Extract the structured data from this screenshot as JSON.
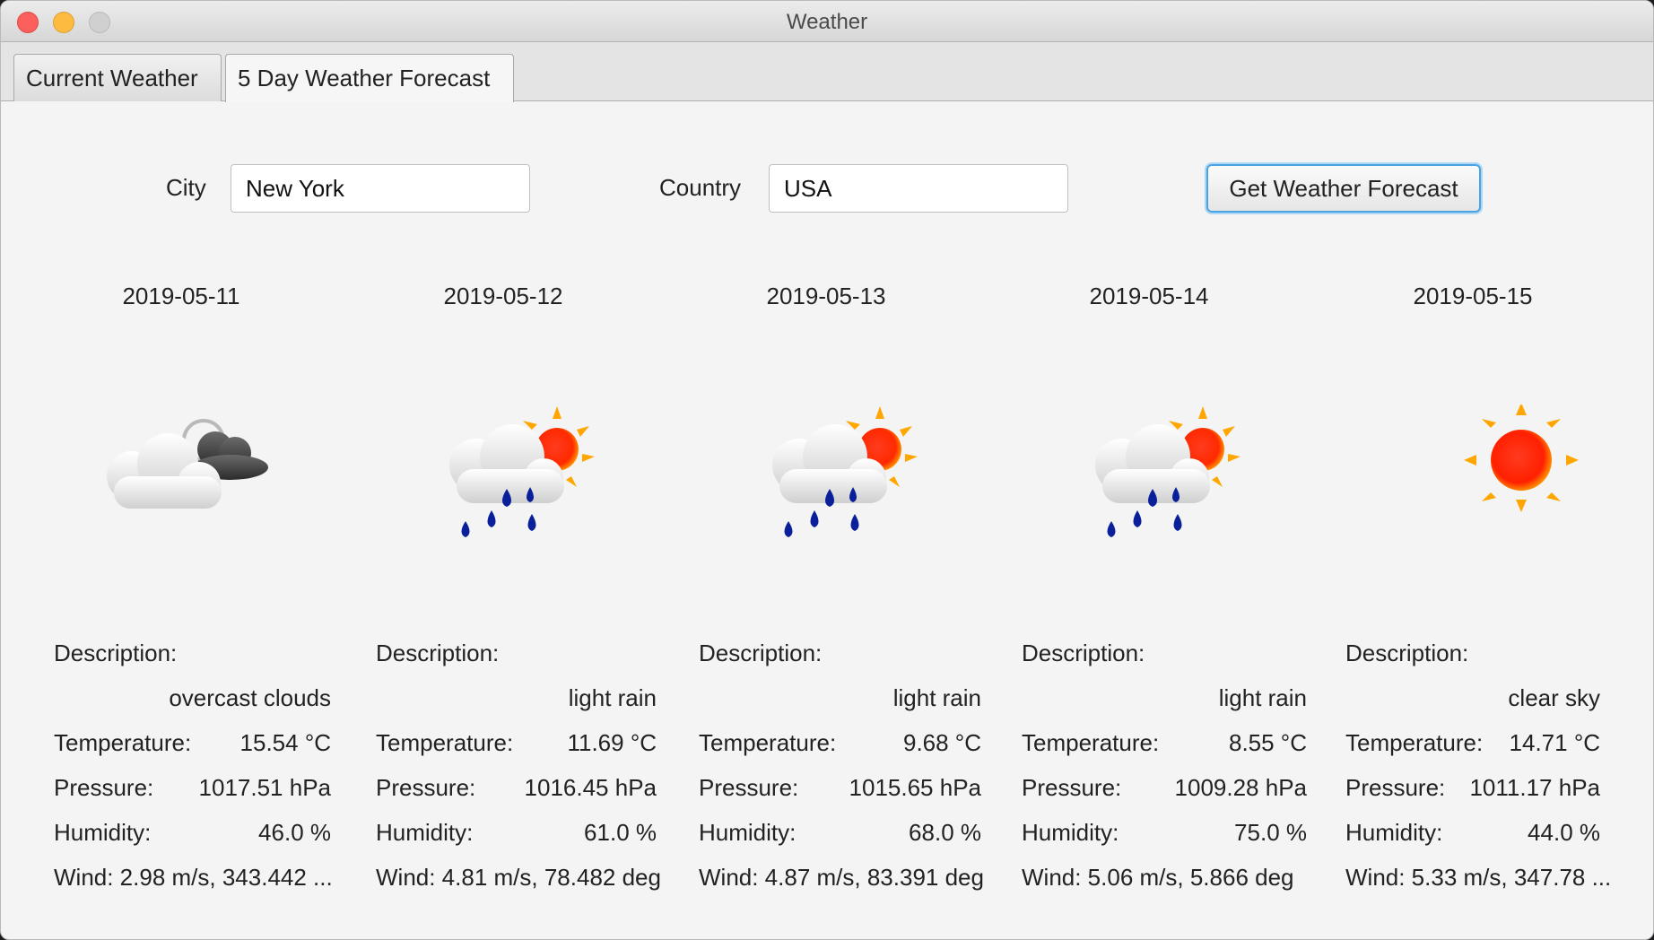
{
  "window": {
    "title": "Weather"
  },
  "tabs": [
    {
      "label": "Current Weather"
    },
    {
      "label": "5 Day Weather Forecast"
    }
  ],
  "form": {
    "city_label": "City",
    "city_value": "New York",
    "country_label": "Country",
    "country_value": "USA",
    "button_label": "Get Weather Forecast"
  },
  "labels": {
    "description": "Description:",
    "temperature": "Temperature:",
    "pressure": "Pressure:",
    "humidity": "Humidity:"
  },
  "days": [
    {
      "date": "2019-05-11",
      "icon": "overcast-clouds-icon",
      "description": "overcast clouds",
      "temperature": "15.54 °C",
      "pressure": "1017.51 hPa",
      "humidity": "46.0 %",
      "wind": "Wind: 2.98 m/s, 343.442 ..."
    },
    {
      "date": "2019-05-12",
      "icon": "light-rain-icon",
      "description": "light rain",
      "temperature": "11.69 °C",
      "pressure": "1016.45 hPa",
      "humidity": "61.0 %",
      "wind": "Wind: 4.81 m/s, 78.482 deg"
    },
    {
      "date": "2019-05-13",
      "icon": "light-rain-icon",
      "description": "light rain",
      "temperature": "9.68 °C",
      "pressure": "1015.65 hPa",
      "humidity": "68.0 %",
      "wind": "Wind: 4.87 m/s, 83.391 deg"
    },
    {
      "date": "2019-05-14",
      "icon": "light-rain-icon",
      "description": "light rain",
      "temperature": "8.55 °C",
      "pressure": "1009.28 hPa",
      "humidity": "75.0 %",
      "wind": "Wind: 5.06 m/s, 5.866 deg"
    },
    {
      "date": "2019-05-15",
      "icon": "clear-sky-icon",
      "description": "clear sky",
      "temperature": "14.71 °C",
      "pressure": "1011.17 hPa",
      "humidity": "44.0 %",
      "wind": "Wind: 5.33 m/s, 347.78 ..."
    }
  ]
}
